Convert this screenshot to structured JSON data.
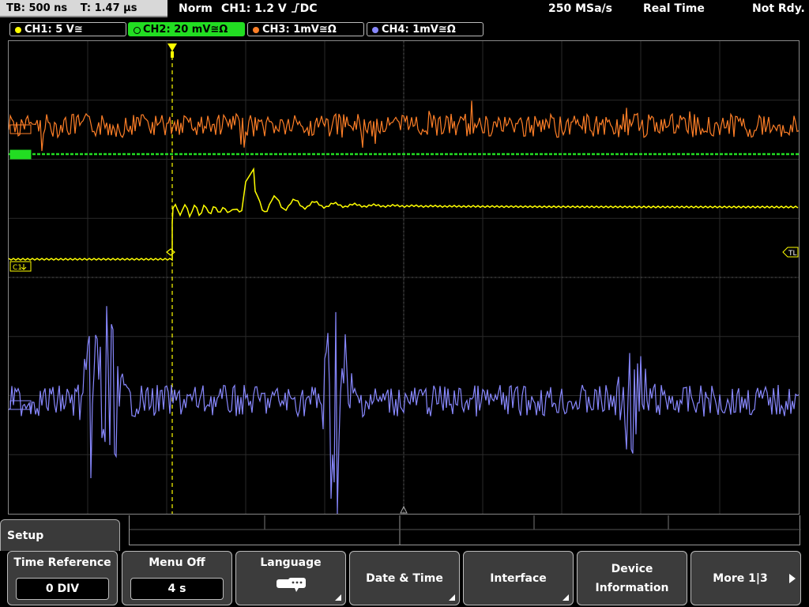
{
  "status": {
    "timebase": "TB: 500 ns",
    "trigger_time": "T: 1.47 µs",
    "trigger_mode": "Norm",
    "trigger_source": "CH1: 1.2 V",
    "trigger_coupling": "DC",
    "sample_rate": "250 MSa/s",
    "acq_mode": "Real Time",
    "run_state": "Not Rdy."
  },
  "channels": [
    {
      "label": "CH1: 5 V≅",
      "color": "#ffff00"
    },
    {
      "label": "CH2: 20 mV≅Ω",
      "color": "#22dd22"
    },
    {
      "label": "CH3: 1mV≅Ω",
      "color": "#ff7f27"
    },
    {
      "label": "CH4: 1mV≅Ω",
      "color": "#8888ff"
    }
  ],
  "markers": {
    "ch1": "C1",
    "trigger_level": "TL"
  },
  "menu": {
    "title": "Setup",
    "softkeys": [
      {
        "label": "Time Reference",
        "value": "0 DIV"
      },
      {
        "label": "Menu Off",
        "value": "4 s"
      },
      {
        "label": "Language"
      },
      {
        "label": "Date & Time"
      },
      {
        "label": "Interface"
      },
      {
        "label_line1": "Device",
        "label_line2": "Information"
      },
      {
        "label": "More 1|3"
      }
    ]
  }
}
